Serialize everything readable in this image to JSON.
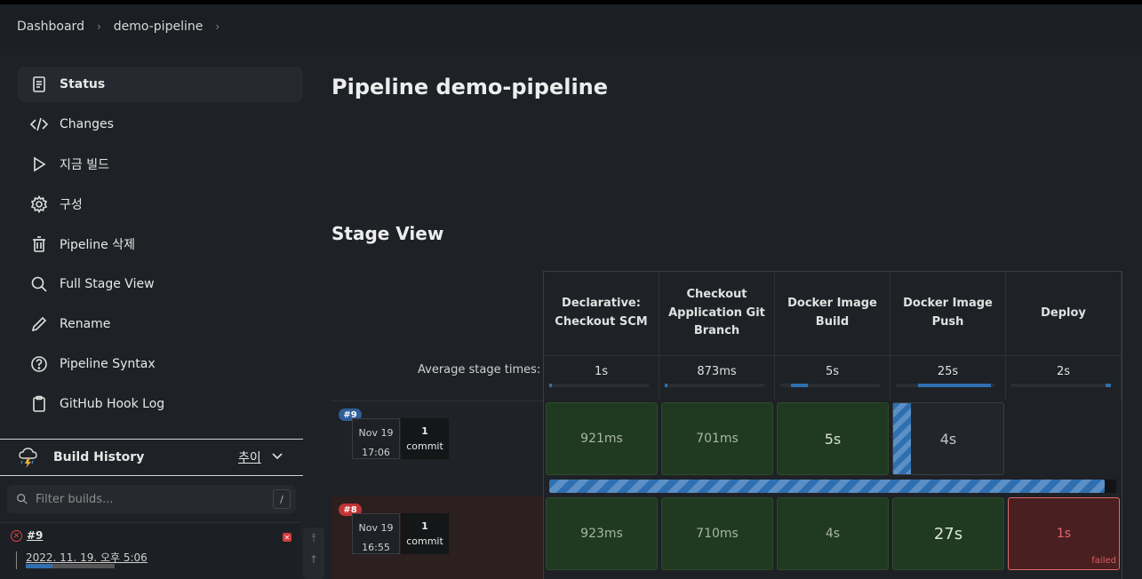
{
  "breadcrumb": [
    "Dashboard",
    "demo-pipeline"
  ],
  "sidebar": {
    "items": [
      {
        "label": "Status",
        "icon": "document-icon"
      },
      {
        "label": "Changes",
        "icon": "code-icon"
      },
      {
        "label": "지금 빌드",
        "icon": "play-icon"
      },
      {
        "label": "구성",
        "icon": "gear-icon"
      },
      {
        "label": "Pipeline 삭제",
        "icon": "trash-icon"
      },
      {
        "label": "Full Stage View",
        "icon": "search-icon"
      },
      {
        "label": "Rename",
        "icon": "pencil-icon"
      },
      {
        "label": "Pipeline Syntax",
        "icon": "help-icon"
      },
      {
        "label": "GitHub Hook Log",
        "icon": "clipboard-icon"
      }
    ]
  },
  "build_history": {
    "title": "Build History",
    "trend_label": "추이",
    "filter_placeholder": "Filter builds...",
    "filter_shortcut": "/",
    "entry": {
      "number": "#9",
      "date": "2022. 11. 19. 오후 5:06",
      "progress": 0.3
    }
  },
  "main": {
    "title": "Pipeline demo-pipeline",
    "stage_view_title": "Stage View",
    "avg_label": "Average stage times:"
  },
  "stages": [
    {
      "name": "Declarative: Checkout SCM",
      "avg": "1s",
      "avg_fraction": 0.03
    },
    {
      "name": "Checkout Application Git Branch",
      "avg": "873ms",
      "avg_fraction": 0.03
    },
    {
      "name": "Docker Image Build",
      "avg": "5s",
      "avg_fraction": 0.17
    },
    {
      "name": "Docker Image Push",
      "avg": "25s",
      "avg_fraction": 0.73
    },
    {
      "name": "Deploy",
      "avg": "2s",
      "avg_fraction": 0.05
    }
  ],
  "runs": [
    {
      "badge": "#9",
      "badge_color": "#2f5f9a",
      "date": "Nov 19",
      "time": "17:06",
      "commits": "1",
      "commit_label": "commit",
      "cells": [
        "921ms",
        "701ms",
        "5s",
        "4s",
        ""
      ]
    },
    {
      "badge": "#8",
      "badge_color": "#c23434",
      "date": "Nov 19",
      "time": "16:55",
      "commits": "1",
      "commit_label": "commit",
      "cells": [
        "923ms",
        "710ms",
        "4s",
        "27s",
        "1s"
      ],
      "failed_label": "failed"
    }
  ],
  "colors": {
    "success": "#1f3a20",
    "running": "#2f6fb0",
    "failed": "#e06a6a"
  }
}
